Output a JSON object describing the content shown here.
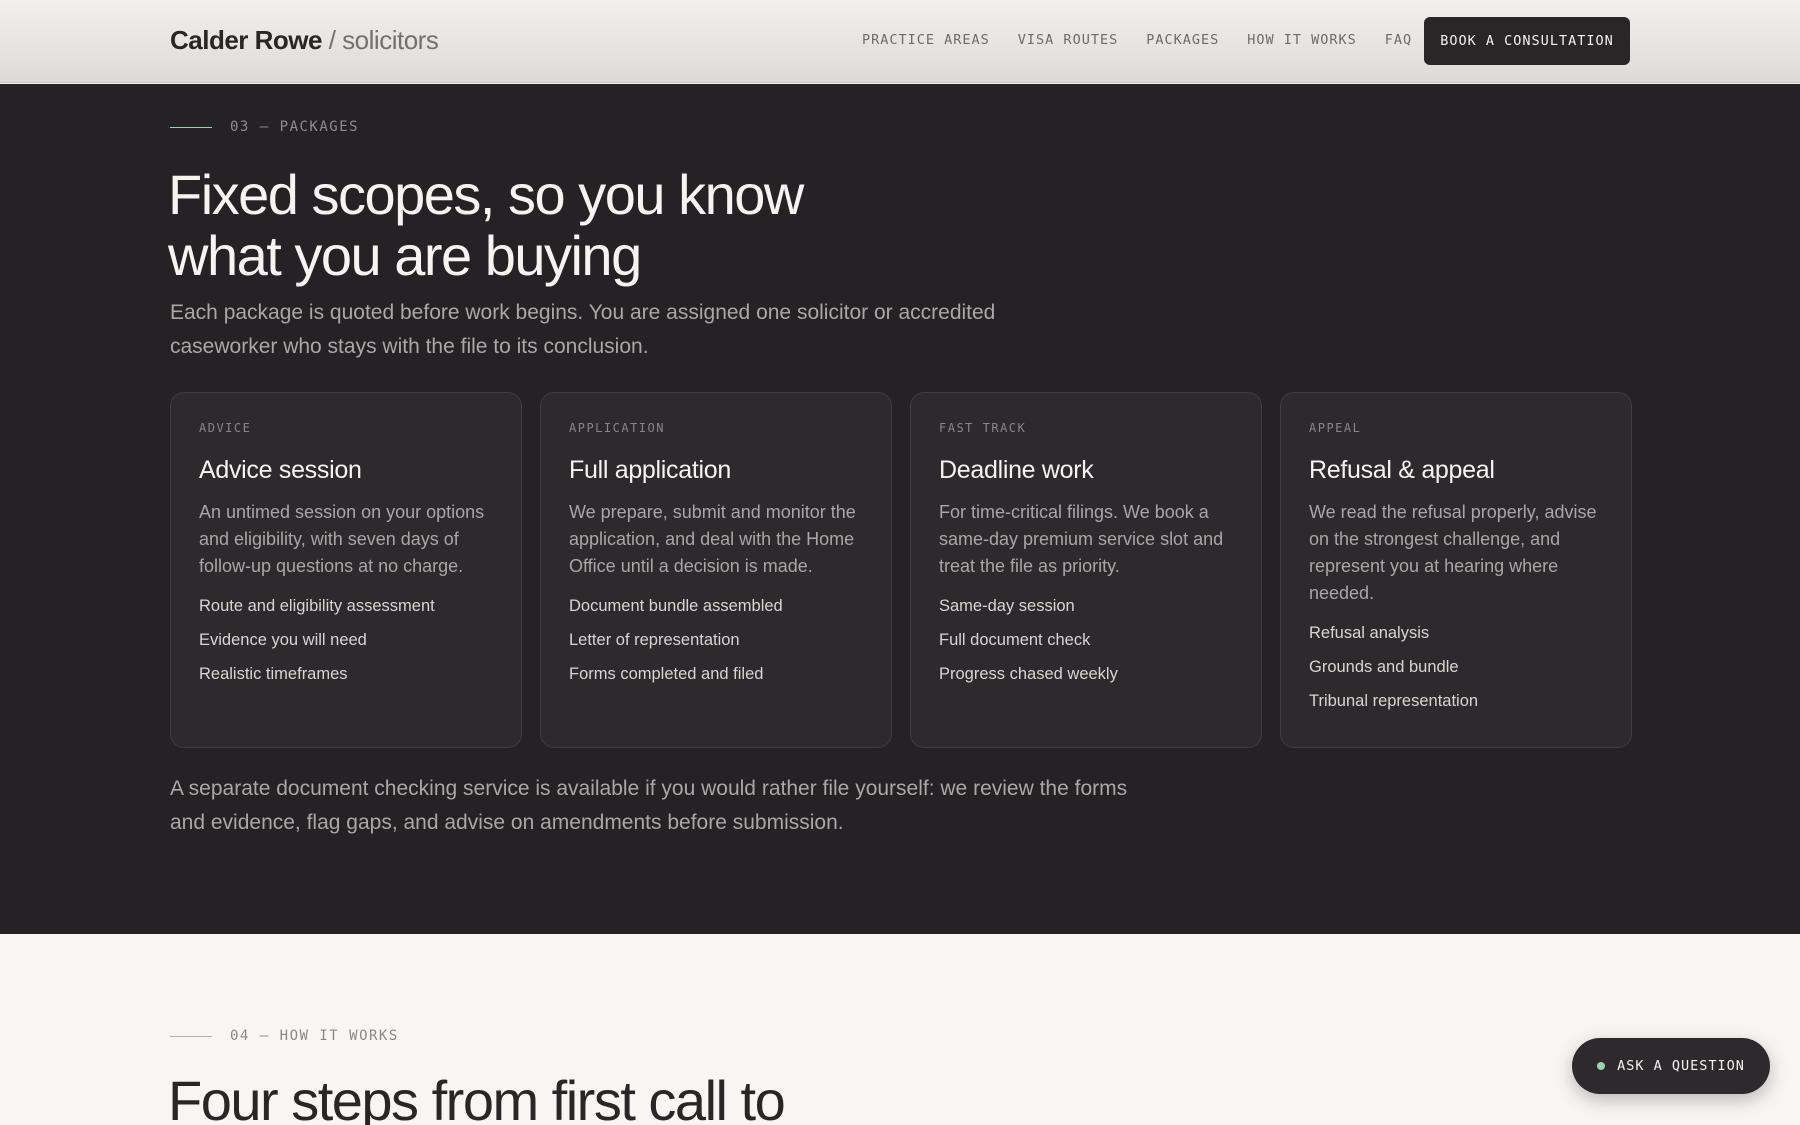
{
  "header": {
    "brand": "Calder Rowe",
    "brand_sub": "/ solicitors",
    "nav": [
      "PRACTICE AREAS",
      "VISA ROUTES",
      "PACKAGES",
      "HOW IT WORKS",
      "FAQ"
    ],
    "cta_label": "BOOK A CONSULTATION"
  },
  "packages_section": {
    "eyebrow": "03 — PACKAGES",
    "title_line1": "Fixed scopes, so you know",
    "title_line2": "what you are buying",
    "lead": "Each package is quoted before work begins. You are assigned one solicitor or accredited caseworker who stays with the file to its conclusion.",
    "cards": [
      {
        "tag": "ADVICE",
        "title": "Advice session",
        "description": "An untimed session on your options and eligibility, with seven days of follow-up questions at no charge.",
        "items": [
          "Route and eligibility assessment",
          "Evidence you will need",
          "Realistic timeframes"
        ]
      },
      {
        "tag": "APPLICATION",
        "title": "Full application",
        "description": "We prepare, submit and monitor the application, and deal with the Home Office until a decision is made.",
        "items": [
          "Document bundle assembled",
          "Letter of representation",
          "Forms completed and filed"
        ]
      },
      {
        "tag": "FAST TRACK",
        "title": "Deadline work",
        "description": "For time-critical filings. We book a same-day premium service slot and treat the file as priority.",
        "items": [
          "Same-day session",
          "Full document check",
          "Progress chased weekly"
        ]
      },
      {
        "tag": "APPEAL",
        "title": "Refusal & appeal",
        "description": "We read the refusal properly, advise on the strongest challenge, and represent you at hearing where needed.",
        "items": [
          "Refusal analysis",
          "Grounds and bundle",
          "Tribunal representation"
        ]
      }
    ],
    "note": "A separate document checking service is available if you would rather file yourself: we review the forms and evidence, flag gaps, and advise on amendments before submission."
  },
  "how_section": {
    "eyebrow": "04 — HOW IT WORKS",
    "title": "Four steps from first call to"
  },
  "floating": {
    "ask_label": "ASK A QUESTION"
  },
  "colors": {
    "dark_bg": "#252124",
    "card_bg": "#2d292c",
    "accent": "#9ad4ad",
    "light_bg": "#f8f6f3"
  }
}
